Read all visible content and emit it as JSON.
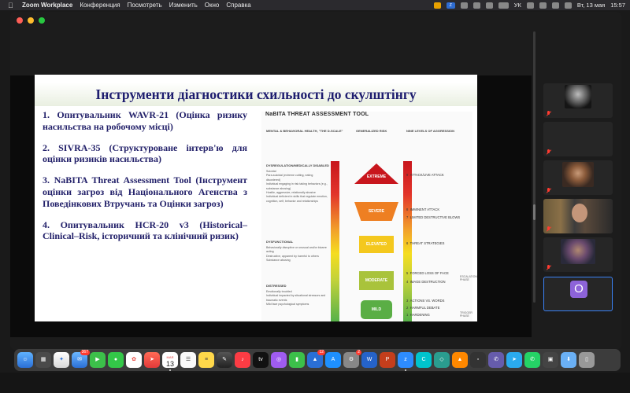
{
  "menubar": {
    "app": "Zoom Workplace",
    "items": [
      "Конференция",
      "Посмотреть",
      "Изменить",
      "Окно",
      "Справка"
    ],
    "input_source": "УК",
    "date": "Вт, 13 мая",
    "time": "15:57"
  },
  "slide": {
    "title": "Інструменти діагностики схильності до скулштінгу",
    "items": [
      "1. Опитувальник WAVR-21 (Оцінка ризику насильства на робочому місці)",
      "2. SIVRA-35 (Структуроване інтерв'ю для оцінки ризиків насильства)",
      "3. NaBITA Threat Assessment Tool (Інструмент оцінки загроз від Національного Агенства з Поведінкових Втручань та Оцінки загроз)",
      "4. Опитувальник HCR-20 v3 (Historical–Clinical–Risk, історичний та клінічний ризик)"
    ]
  },
  "nabita": {
    "title": "NaBITA THREAT ASSESSMENT TOOL",
    "col_left": "MENTAL & BEHAVIORAL HEALTH, \"THE D-SCALE\"",
    "col_mid": "GENERALIZED RISK",
    "col_right": "NINE LEVELS OF AGGRESSION",
    "risk_levels": [
      "EXTREME",
      "SEVERE",
      "ELEVATED",
      "MODERATE",
      "MILD"
    ],
    "aggression": [
      {
        "n": "9",
        "label": "ATTACK/LIVE ATTACK"
      },
      {
        "n": "8",
        "label": "IMMINENT ATTACK"
      },
      {
        "n": "7",
        "label": "LIMITED DESTRUCTIVE BLOWS"
      },
      {
        "n": "6",
        "label": "THREAT STRATEGIES"
      },
      {
        "n": "5",
        "label": "FORCED LOSS OF FACE"
      },
      {
        "n": "4",
        "label": "IMAGE DESTRUCTION"
      },
      {
        "n": "3",
        "label": "ACTIONS VS. WORDS"
      },
      {
        "n": "2",
        "label": "HARMFUL DEBATE"
      },
      {
        "n": "1",
        "label": "HARDENING"
      }
    ],
    "phases": [
      "ESCALATION PHASE",
      "TRIGGER PHASE"
    ],
    "d_scale": {
      "dysregulation": {
        "head": "DYSREGULATION/MEDICALLY DISABLED",
        "bullets": [
          "Suicidal",
          "Para-suicidal (extreme cutting, eating disordered)",
          "Individual engaging in risk taking behaviors (e.g., substance abusing)",
          "Hostile, aggressive, relationally abusive",
          "Individual deficient in skills that regulate emotion, cognition, self, behavior and relationships"
        ]
      },
      "distress": {
        "head": "DYSFUNCTIONAL",
        "bullets": [
          "Behaviorally disruptive or unusual and/or bizarre acting",
          "Destructive, apparent by harmful to others",
          "Substance abusing"
        ]
      },
      "distress2": {
        "head": "DISTRESSED",
        "bullets": [
          "Emotionally troubled",
          "Individual impacted by situational stressors and traumatic events",
          "Mild face psychological symptoms"
        ]
      }
    }
  },
  "participants": [
    {
      "name": "",
      "type": "video"
    },
    {
      "name": "",
      "type": "big",
      "big": ""
    },
    {
      "name": "",
      "type": "video"
    },
    {
      "name": "",
      "type": "video"
    },
    {
      "name": "",
      "type": "video"
    },
    {
      "name": "",
      "type": "avatar",
      "initial": "О"
    }
  ],
  "dock": {
    "mail_badge": "367",
    "calendar_day": "13",
    "calendar_month": "МАЯ",
    "badge_2": "12",
    "badge_3": "2"
  }
}
